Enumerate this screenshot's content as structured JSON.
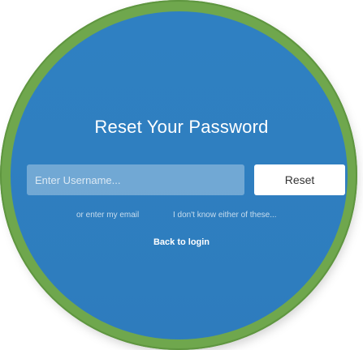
{
  "form": {
    "title": "Reset Your Password",
    "username_placeholder": "Enter Username...",
    "username_value": "",
    "reset_label": "Reset",
    "alt_email_link": "or enter my email",
    "alt_unknown_link": "I don't know either of these...",
    "back_link": "Back to login"
  },
  "colors": {
    "ring": "#6fa74d",
    "panel": "#2f80c2",
    "button": "#ffffff",
    "text": "#ffffff"
  }
}
